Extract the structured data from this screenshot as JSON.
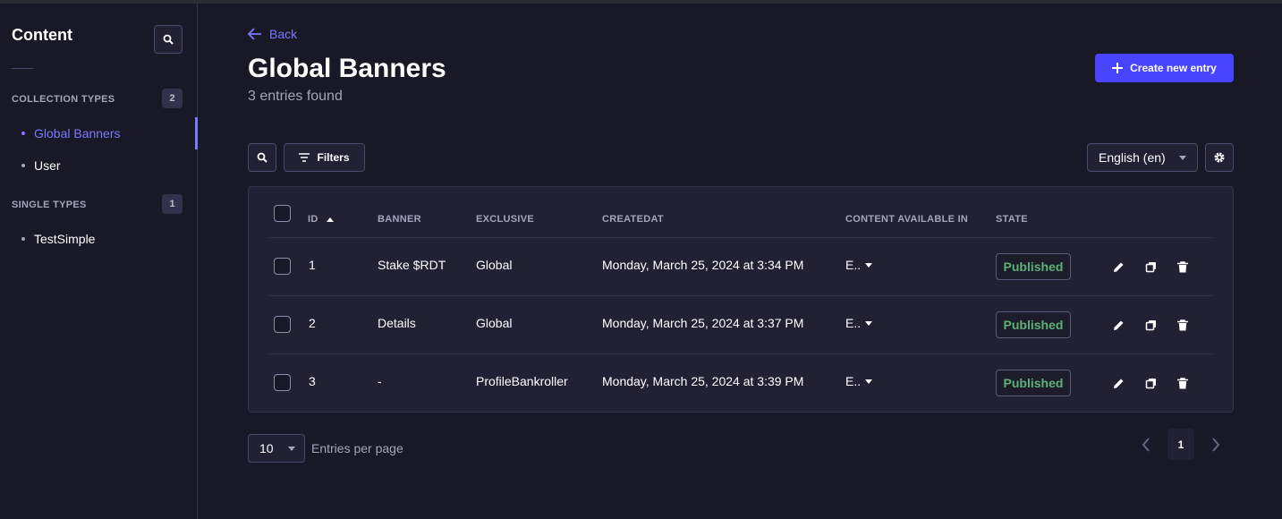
{
  "sidebar": {
    "title": "Content",
    "collection_types": {
      "label": "COLLECTION TYPES",
      "count": "2",
      "items": [
        "Global Banners",
        "User"
      ]
    },
    "single_types": {
      "label": "SINGLE TYPES",
      "count": "1",
      "items": [
        "TestSimple"
      ]
    }
  },
  "header": {
    "back_label": "Back",
    "title": "Global Banners",
    "subtitle": "3 entries found",
    "create_label": "Create new entry"
  },
  "toolbar": {
    "filters_label": "Filters",
    "locale": "English (en)"
  },
  "table": {
    "headers": [
      "ID",
      "BANNER",
      "EXCLUSIVE",
      "CREATEDAT",
      "CONTENT AVAILABLE IN",
      "STATE"
    ],
    "rows": [
      {
        "id": "1",
        "banner": "Stake $RDT",
        "exclusive": "Global",
        "createdat": "Monday, March 25, 2024 at 3:34 PM",
        "locales": "E..",
        "state": "Published"
      },
      {
        "id": "2",
        "banner": "Details",
        "exclusive": "Global",
        "createdat": "Monday, March 25, 2024 at 3:37 PM",
        "locales": "E..",
        "state": "Published"
      },
      {
        "id": "3",
        "banner": "-",
        "exclusive": "ProfileBankroller",
        "createdat": "Monday, March 25, 2024 at 3:39 PM",
        "locales": "E..",
        "state": "Published"
      }
    ]
  },
  "pagination": {
    "page_size": "10",
    "page_size_label": "Entries per page",
    "current_page": "1"
  },
  "colors": {
    "accent": "#7b79ff",
    "primary_button": "#4945ff",
    "published": "#5cb176",
    "background": "#181826",
    "surface": "#212134"
  },
  "icons": [
    "search-icon",
    "arrow-left-icon",
    "plus-icon",
    "filter-icon",
    "chevron-down-icon",
    "gear-icon",
    "sort-up-icon",
    "pencil-icon",
    "duplicate-icon",
    "trash-icon",
    "chevron-left-icon",
    "chevron-right-icon"
  ]
}
